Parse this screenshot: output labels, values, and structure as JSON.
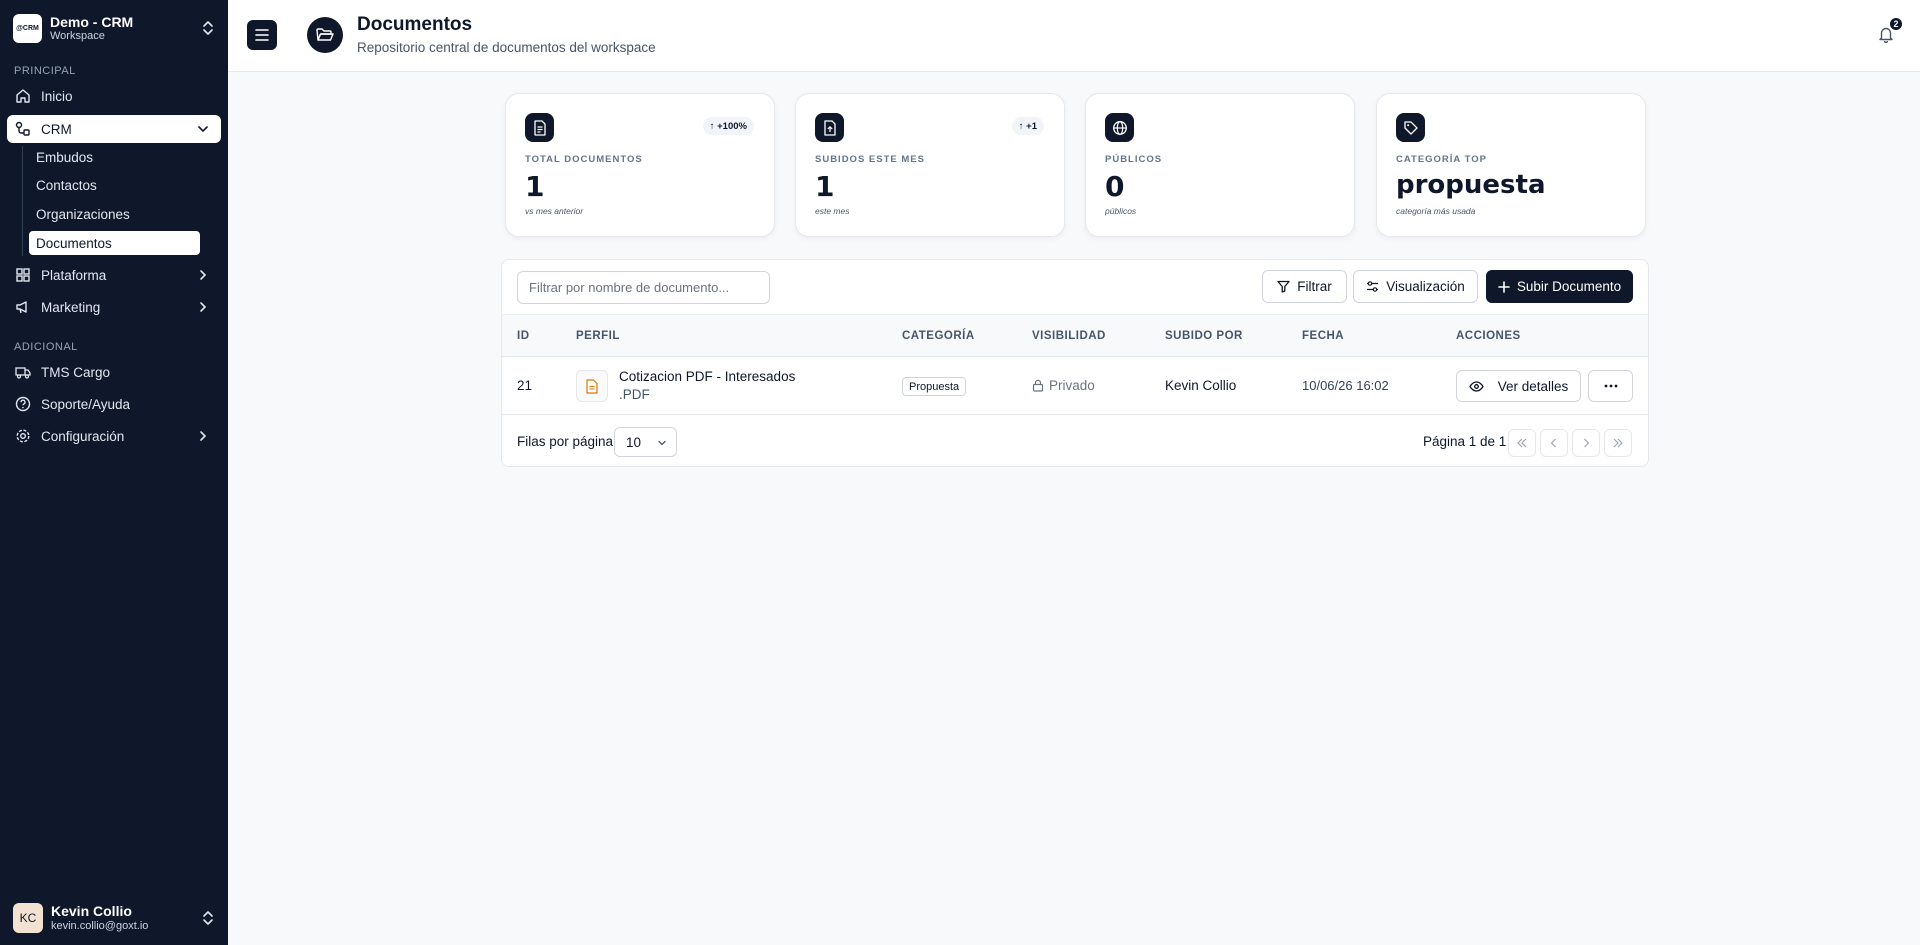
{
  "workspace": {
    "logo_text": "@CRM",
    "name": "Demo - CRM",
    "subtitle": "Workspace"
  },
  "sidebar": {
    "section_principal": "PRINCIPAL",
    "section_adicional": "ADICIONAL",
    "items": [
      {
        "label": "Inicio",
        "icon": "home-icon"
      },
      {
        "label": "CRM",
        "icon": "crm-icon"
      },
      {
        "label": "Plataforma",
        "icon": "grid-icon"
      },
      {
        "label": "Marketing",
        "icon": "megaphone-icon"
      },
      {
        "label": "TMS Cargo",
        "icon": "truck-icon"
      },
      {
        "label": "Soporte/Ayuda",
        "icon": "help-icon"
      },
      {
        "label": "Configuración",
        "icon": "gear-icon"
      }
    ],
    "crm_sub": [
      "Embudos",
      "Contactos",
      "Organizaciones",
      "Documentos"
    ]
  },
  "user": {
    "initials": "KC",
    "name": "Kevin Collio",
    "email": "kevin.collio@goxt.io"
  },
  "header": {
    "title": "Documentos",
    "subtitle": "Repositorio central de documentos del workspace",
    "notifications": "2"
  },
  "stats": [
    {
      "label": "TOTAL DOCUMENTOS",
      "value": "1",
      "note": "vs mes anterior",
      "badge": "↑ +100%",
      "icon": "document-icon"
    },
    {
      "label": "SUBIDOS ESTE MES",
      "value": "1",
      "note": "este mes",
      "badge": "↑ +1",
      "icon": "file-upload-icon"
    },
    {
      "label": "PÚBLICOS",
      "value": "0",
      "note": "públicos",
      "badge": "",
      "icon": "globe-icon"
    },
    {
      "label": "CATEGORÍA TOP",
      "value": "propuesta",
      "note": "categoría más usada",
      "badge": "",
      "icon": "tag-icon"
    }
  ],
  "toolbar": {
    "filter_placeholder": "Filtrar por nombre de documento...",
    "filter_label": "Filtrar",
    "view_label": "Visualización",
    "upload_label": "Subir Documento"
  },
  "table": {
    "columns": [
      "ID",
      "PERFIL",
      "CATEGORÍA",
      "VISIBILIDAD",
      "SUBIDO POR",
      "FECHA",
      "ACCIONES"
    ],
    "rows": [
      {
        "id": "21",
        "name": "Cotizacion PDF - Interesados",
        "ext": ".PDF",
        "category": "Propuesta",
        "visibility": "Privado",
        "uploaded_by": "Kevin Collio",
        "date": "10/06/26 16:02",
        "action_label": "Ver detalles"
      }
    ]
  },
  "pagination": {
    "rows_label": "Filas por página",
    "rows_value": "10",
    "page_info": "Página 1 de 1"
  }
}
